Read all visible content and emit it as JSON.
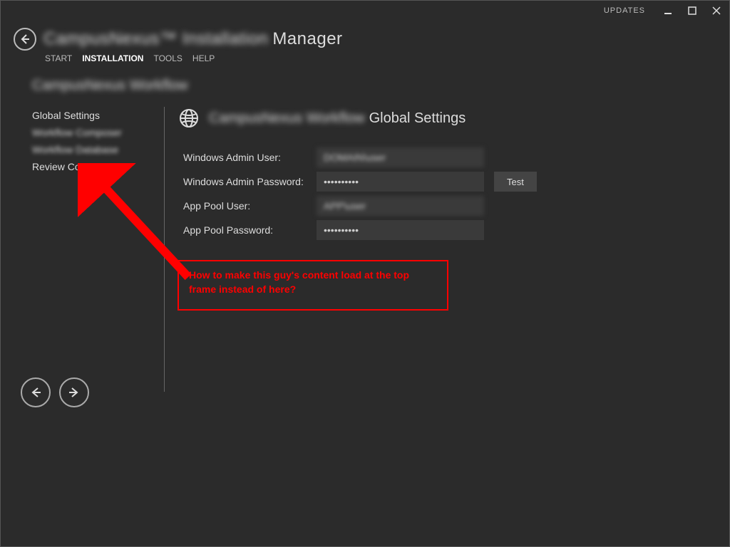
{
  "titlebar": {
    "updates": "UPDATES"
  },
  "header": {
    "app_title_blur": "CampusNexus™ Installation",
    "app_title_tail": "Manager"
  },
  "menu": {
    "items": [
      {
        "label": "START",
        "active": false
      },
      {
        "label": "INSTALLATION",
        "active": true
      },
      {
        "label": "TOOLS",
        "active": false
      },
      {
        "label": "HELP",
        "active": false
      }
    ]
  },
  "subheader": {
    "text": "CampusNexus Workflow"
  },
  "sidebar": {
    "items": [
      {
        "label": "Global Settings",
        "blurred": false
      },
      {
        "label": "Workflow Composer",
        "blurred": true
      },
      {
        "label": "Workflow Database",
        "blurred": true
      },
      {
        "label": "Review Configuration",
        "blurred": false
      }
    ]
  },
  "panel": {
    "title_blur": "CampusNexus Workflow",
    "title_tail": "Global Settings"
  },
  "form": {
    "rows": [
      {
        "label": "Windows Admin User:",
        "value": "DOMAIN\\user",
        "type": "text",
        "blurred": true,
        "test": false
      },
      {
        "label": "Windows Admin Password:",
        "value": "••••••••••",
        "type": "password",
        "blurred": false,
        "test": true
      },
      {
        "label": "App Pool User:",
        "value": "APP\\user",
        "type": "text",
        "blurred": true,
        "test": false
      },
      {
        "label": "App Pool Password:",
        "value": "••••••••••",
        "type": "password",
        "blurred": false,
        "test": false
      }
    ],
    "test_button": "Test"
  },
  "annotation": {
    "text": "How to make this guy's content load at the top frame instead of here?"
  }
}
